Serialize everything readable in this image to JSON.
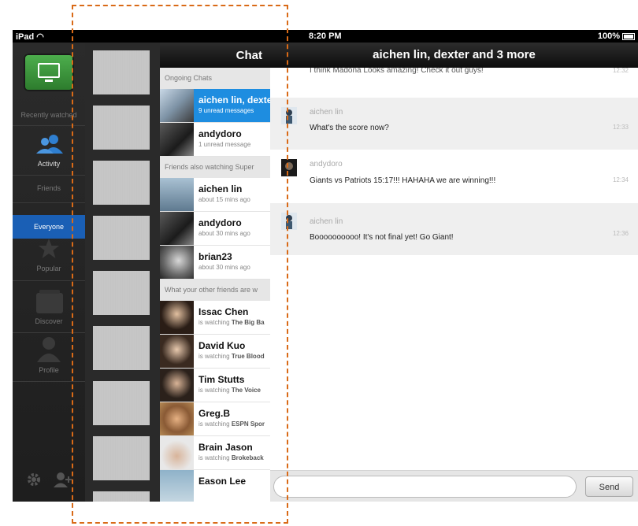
{
  "status_bar": {
    "carrier": "iPad",
    "time": "8:20 PM",
    "battery": "100%"
  },
  "left_nav": {
    "recently_watched": "Recently watched",
    "activity": "Activity",
    "friends": "Friends",
    "everyone": "Everyone",
    "popular": "Popular",
    "discover": "Discover",
    "profile": "Profile"
  },
  "chat_list": {
    "title": "Chat",
    "sections": {
      "ongoing": "Ongoing Chats",
      "also_watching": "Friends also watching Super",
      "other_friends": "What your other friends are w"
    },
    "ongoing": [
      {
        "name": "aichen lin, dexte",
        "sub": "9 unread messages"
      },
      {
        "name": "andydoro",
        "sub": "1 unread message"
      }
    ],
    "also_watching": [
      {
        "name": "aichen lin",
        "sub": "about 15 mins ago"
      },
      {
        "name": "andydoro",
        "sub": "about 30 mins ago"
      },
      {
        "name": "brian23",
        "sub": "about 30 mins ago"
      }
    ],
    "other_friends": [
      {
        "name": "Issac Chen",
        "sub_prefix": "is watching",
        "show": "The Big Ba"
      },
      {
        "name": "David Kuo",
        "sub_prefix": "is watching",
        "show": "True Blood"
      },
      {
        "name": "Tim Stutts",
        "sub_prefix": "is watching",
        "show": "The Voice"
      },
      {
        "name": "Greg.B",
        "sub_prefix": "is watching",
        "show": "ESPN Spor"
      },
      {
        "name": "Brain Jason",
        "sub_prefix": "is watching",
        "show": "Brokeback"
      },
      {
        "name": "Eason Lee",
        "sub_prefix": "",
        "show": ""
      }
    ]
  },
  "conversation": {
    "title": "aichen lin, dexter and 3 more",
    "partial_message": "I think Madona Looks amazing! Check it out guys!",
    "messages": [
      {
        "author": "aichen lin",
        "text": "What's the score now?",
        "time": "12:33"
      },
      {
        "author": "andydoro",
        "text": "Giants vs Patriots 15:17!!! HAHAHA we are winning!!!",
        "time": "12:34"
      },
      {
        "author": "aichen lin",
        "text": "Boooooooooo! It's not final yet! Go Giant!",
        "time": "12:36"
      }
    ],
    "input_placeholder": "",
    "send_label": "Send"
  },
  "colors": {
    "accent_blue": "#1e8de0",
    "nav_active": "#1a5fb5",
    "tv_green": "#3c9a3c",
    "annotation_orange": "#d96a17"
  }
}
